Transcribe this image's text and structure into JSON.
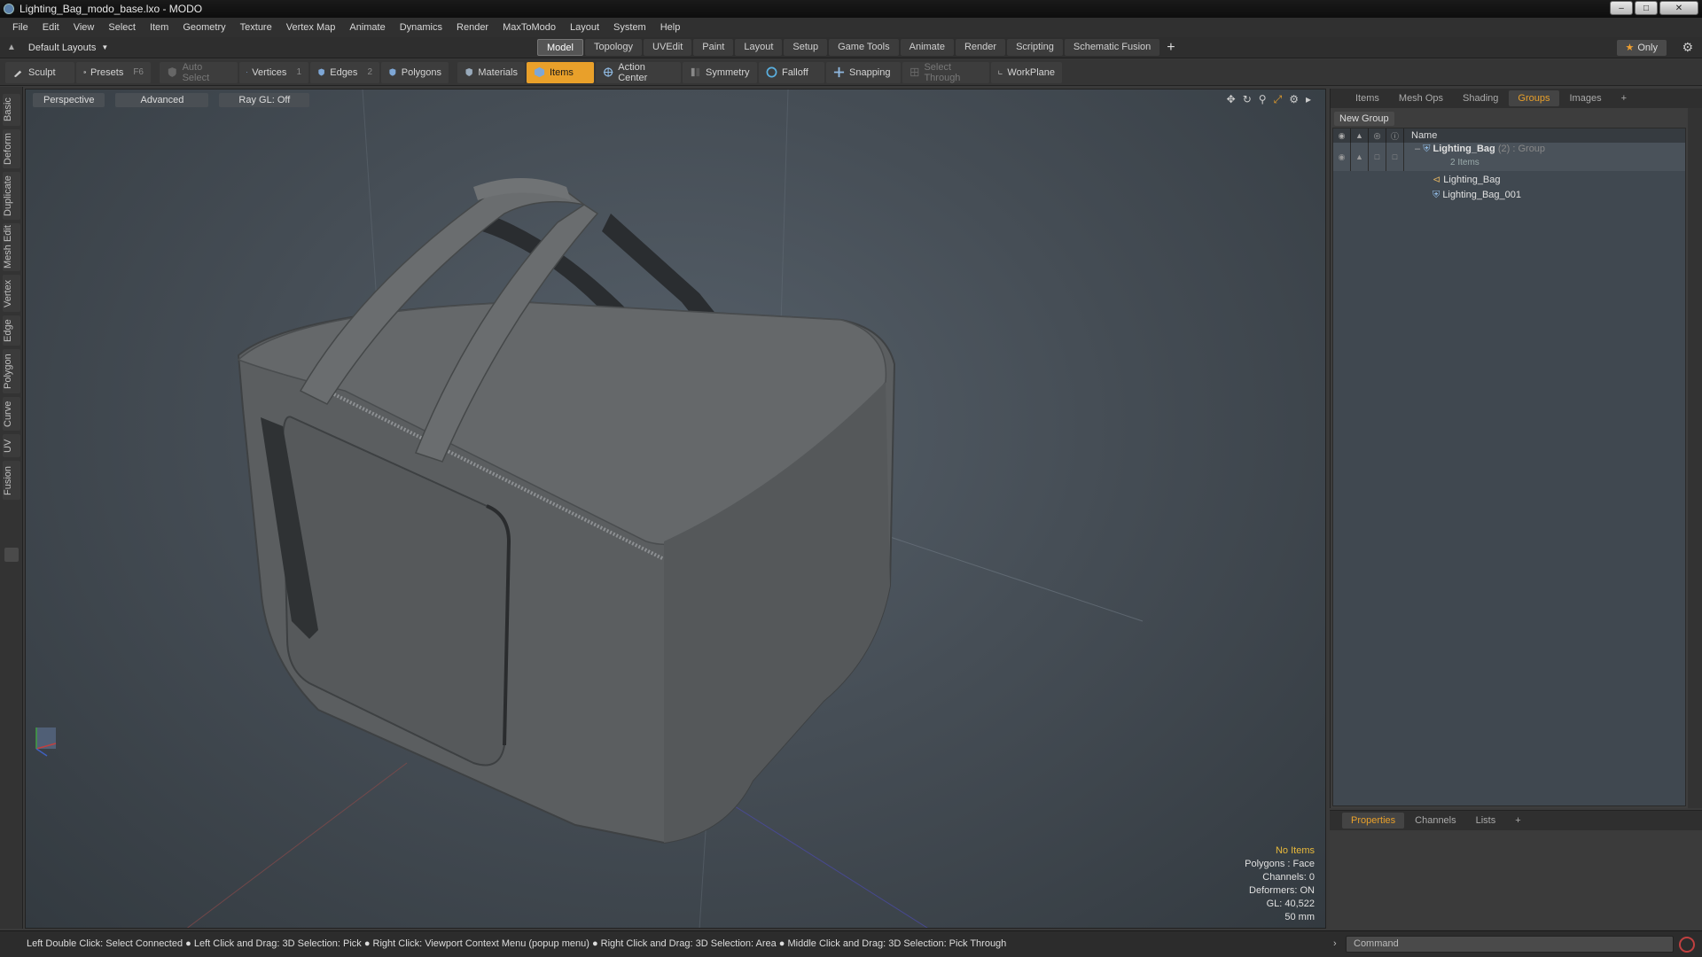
{
  "window": {
    "title": "Lighting_Bag_modo_base.lxo - MODO"
  },
  "menu": [
    "File",
    "Edit",
    "View",
    "Select",
    "Item",
    "Geometry",
    "Texture",
    "Vertex Map",
    "Animate",
    "Dynamics",
    "Render",
    "MaxToModo",
    "Layout",
    "System",
    "Help"
  ],
  "layout": {
    "current": "Default Layouts",
    "tabs": [
      "Model",
      "Topology",
      "UVEdit",
      "Paint",
      "Layout",
      "Setup",
      "Game Tools",
      "Animate",
      "Render",
      "Scripting",
      "Schematic Fusion"
    ],
    "active_tab": "Model",
    "only_label": "Only"
  },
  "toolbar": {
    "sculpt": "Sculpt",
    "presets": "Presets",
    "presets_key": "F6",
    "auto_select": "Auto Select",
    "vertices": "Vertices",
    "vertices_key": "1",
    "edges": "Edges",
    "edges_key": "2",
    "polygons": "Polygons",
    "materials": "Materials",
    "items": "Items",
    "action_center": "Action Center",
    "symmetry": "Symmetry",
    "falloff": "Falloff",
    "snapping": "Snapping",
    "select_through": "Select Through",
    "workplane": "WorkPlane"
  },
  "left_tabs": [
    "Basic",
    "Deform",
    "Duplicate",
    "Mesh Edit",
    "Vertex",
    "Edge",
    "Polygon",
    "Curve",
    "UV",
    "Fusion"
  ],
  "viewport": {
    "view": "Perspective",
    "mode": "Advanced",
    "raygl": "Ray GL: Off",
    "info": {
      "items": "No Items",
      "polygons": "Polygons : Face",
      "channels": "Channels: 0",
      "deformers": "Deformers: ON",
      "gl": "GL: 40,522",
      "units": "50 mm"
    }
  },
  "right_panel": {
    "tabs": [
      "Items",
      "Mesh Ops",
      "Shading",
      "Groups",
      "Images"
    ],
    "active_tab": "Groups",
    "new_group": "New Group",
    "name_header": "Name",
    "group": {
      "name": "Lighting_Bag",
      "count": "(2)",
      "type": ": Group",
      "sub": "2 Items",
      "children": [
        "Lighting_Bag",
        "Lighting_Bag_001"
      ]
    }
  },
  "properties_panel": {
    "tabs": [
      "Properties",
      "Channels",
      "Lists"
    ],
    "active_tab": "Properties"
  },
  "status": {
    "hint": "Left Double Click: Select Connected ● Left Click and Drag: 3D Selection: Pick ● Right Click: Viewport Context Menu (popup menu) ● Right Click and Drag: 3D Selection: Area ● Middle Click and Drag: 3D Selection: Pick Through",
    "command_placeholder": "Command"
  },
  "colors": {
    "accent": "#e9a02a",
    "highlight_text": "#e8b93c"
  }
}
